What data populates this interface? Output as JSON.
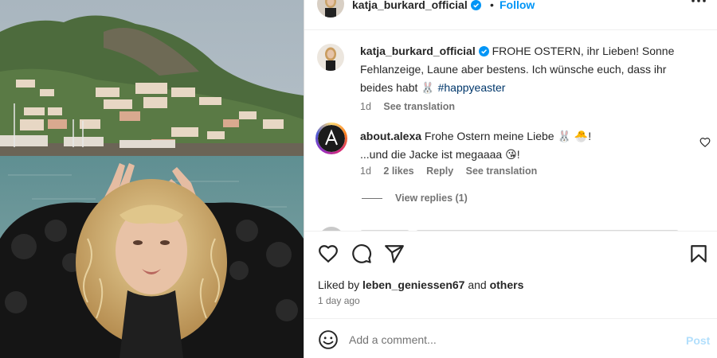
{
  "post": {
    "username": "katja_burkard_official",
    "dot": "•",
    "follow_label": "Follow",
    "more_icon": "more-horizontal-icon"
  },
  "caption": {
    "username": "katja_burkard_official",
    "text": " FROHE OSTERN, ihr Lieben! Sonne Fehlanzeige, Laune aber bestens. Ich wünsche euch, dass ihr beides habt 🐰 ",
    "hashtag": "#happyeaster",
    "time": "1d",
    "see_translation": "See translation"
  },
  "comments": [
    {
      "username": "about.alexa",
      "line1": " Frohe Ostern meine Liebe 🐰 🐣!",
      "line2": "...und die Jacke ist megaaaa 😘!",
      "time": "1d",
      "likes": "2 likes",
      "reply": "Reply",
      "see_translation": "See translation",
      "view_replies": "View replies (1)"
    }
  ],
  "actions": {
    "liked_prefix": "Liked by ",
    "liked_user": "leben_geniessen67",
    "liked_and": " and ",
    "liked_others": "others",
    "time_ago": "1 day ago"
  },
  "composer": {
    "placeholder": "Add a comment...",
    "post_label": "Post"
  },
  "colors": {
    "accent": "#0095f6",
    "post_disabled": "#b2dffc",
    "hashtag": "#00376b"
  }
}
